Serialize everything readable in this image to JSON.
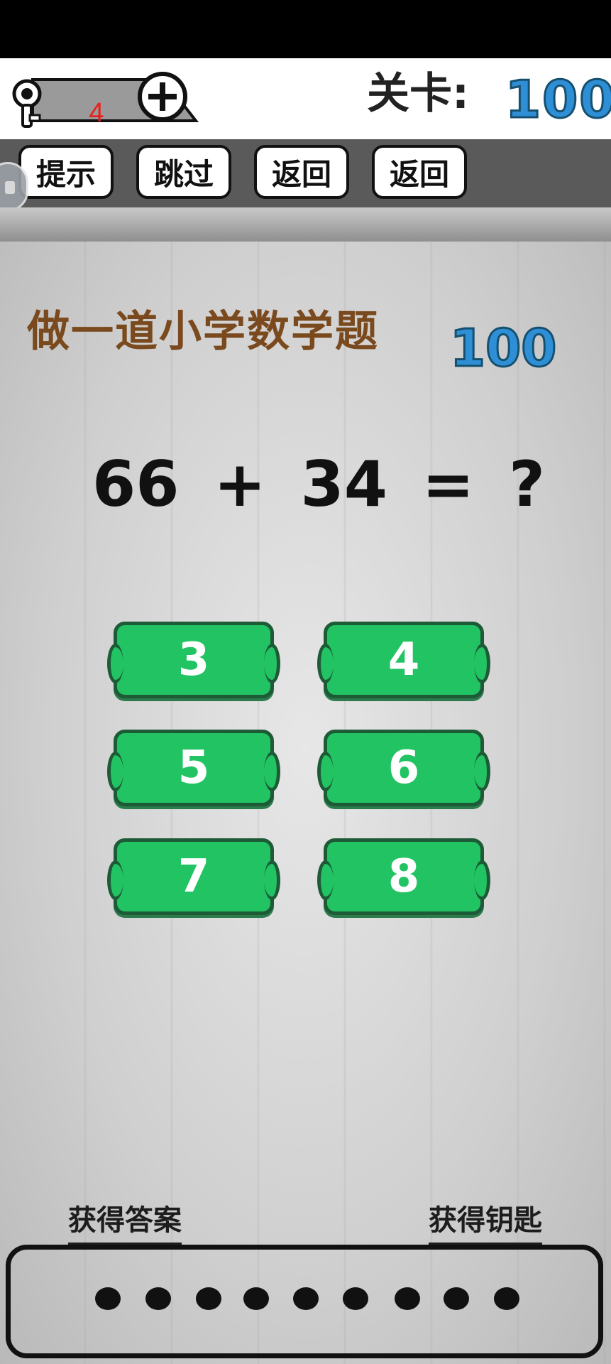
{
  "header": {
    "keys_count": "4",
    "level_label": "关卡:",
    "level_value": "100"
  },
  "toolbar": {
    "hint": "提示",
    "skip": "跳过",
    "back1": "返回",
    "back2": "返回"
  },
  "question": {
    "title": "做一道小学数学题",
    "number": "100",
    "equation": "66 + 34 = ?"
  },
  "answers": [
    "3",
    "4",
    "5",
    "6",
    "7",
    "8"
  ],
  "bottom": {
    "get_answer": "获得答案",
    "get_key": "获得钥匙",
    "slots_count": 9
  },
  "colors": {
    "accent_blue": "#2f8fd6",
    "button_green": "#22c363",
    "title_brown": "#7a4a1e",
    "key_count_red": "#e8201c"
  },
  "icons": [
    "key-icon",
    "plus-icon"
  ]
}
